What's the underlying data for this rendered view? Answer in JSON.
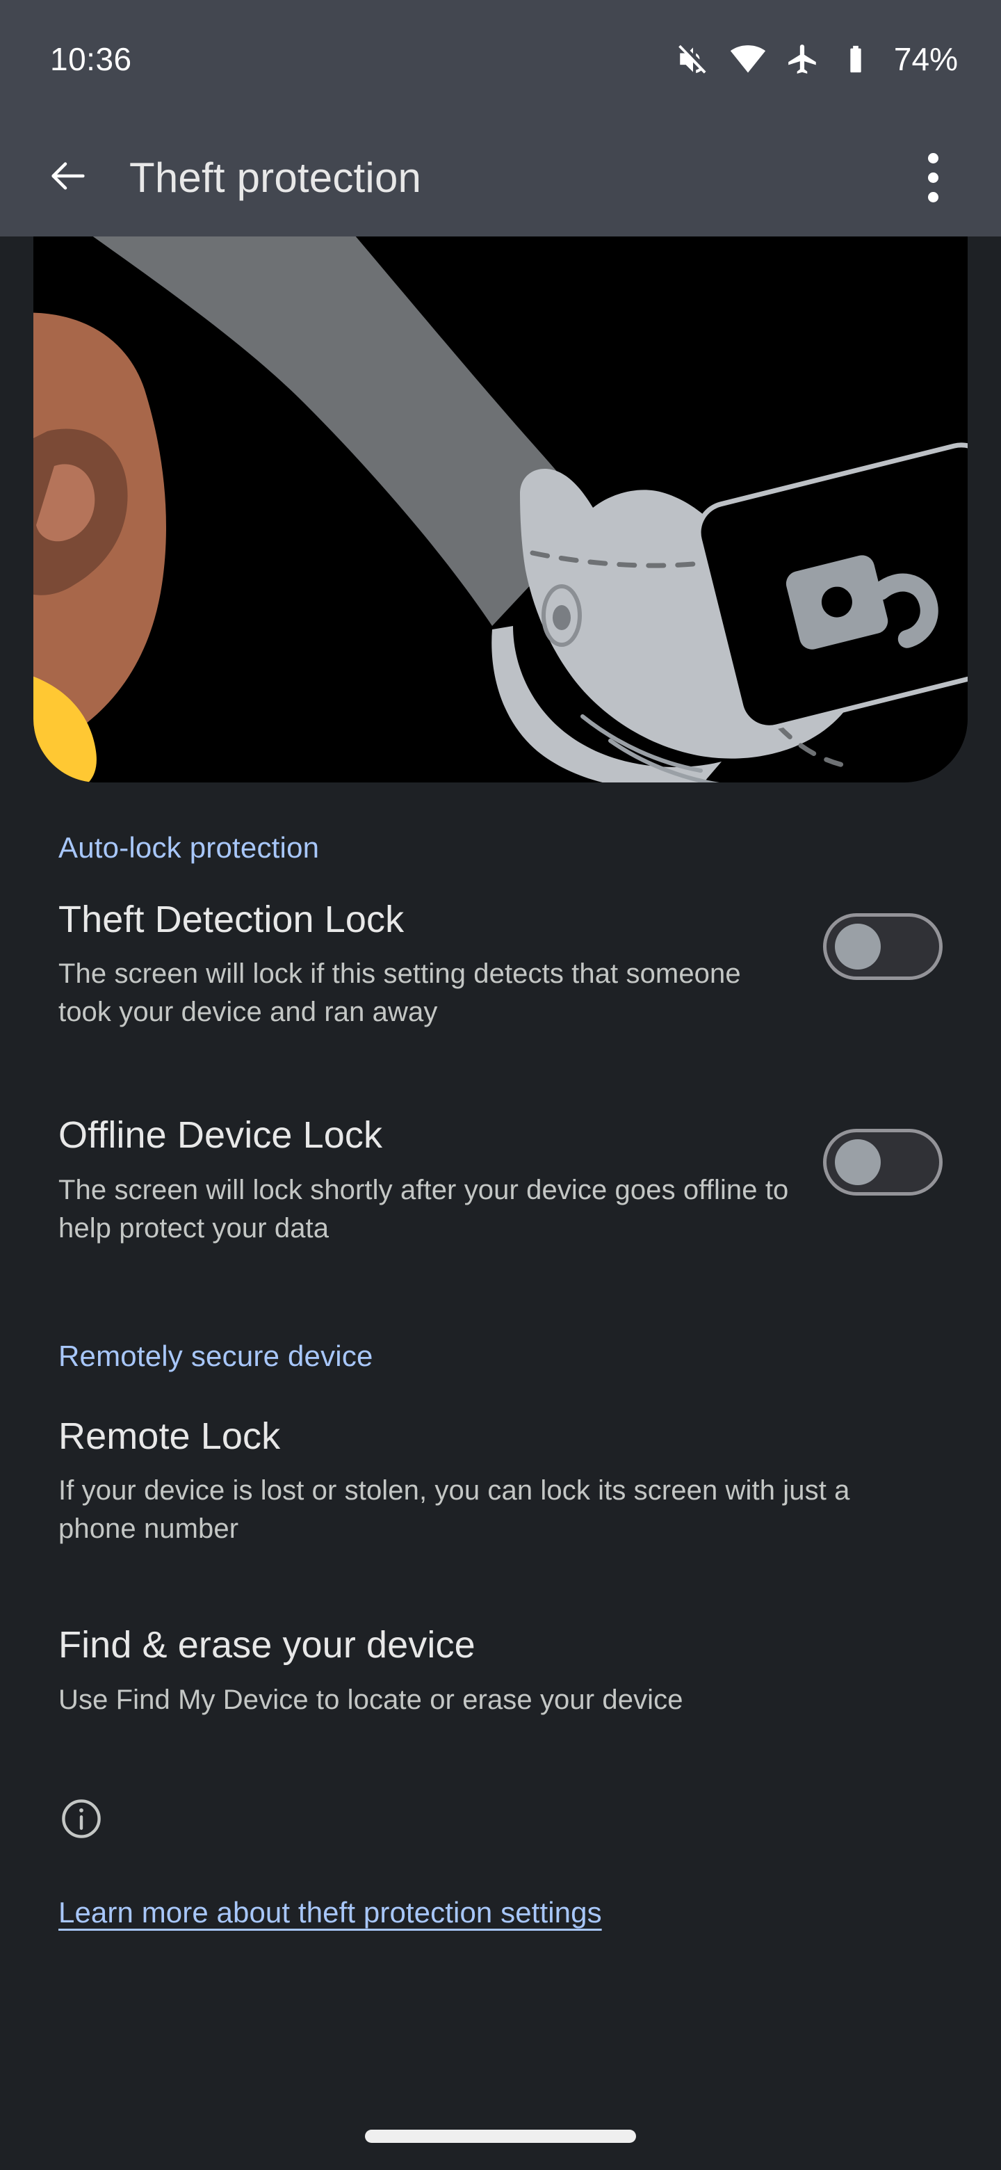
{
  "status_bar": {
    "time": "10:36",
    "battery_percent": "74%",
    "icons": [
      "volume-off-icon",
      "wifi-icon",
      "airplane-mode-icon",
      "battery-icon"
    ]
  },
  "app_bar": {
    "back_icon": "back-arrow-icon",
    "title": "Theft protection",
    "overflow_icon": "more-options-icon"
  },
  "hero": {
    "illustration_name": "theft-snatching-phone-illustration",
    "colors": {
      "background": "#000000",
      "thief_sleeve": "#6E7174",
      "thief_glove": "#BDC1C6",
      "victim_hand": "#A8674A",
      "victim_hand_shadow": "#7B4A36",
      "victim_sleeve": "#FFC833",
      "phone_screen": "#000000",
      "phone_frame": "#BDC1C6",
      "lock_icon": "#9AA0A6"
    }
  },
  "sections": [
    {
      "header": "Auto-lock protection",
      "items": [
        {
          "title": "Theft Detection Lock",
          "summary": "The screen will lock if this setting detects that someone took your device and ran away",
          "has_toggle": true,
          "toggle_state": "off"
        },
        {
          "title": "Offline Device Lock",
          "summary": "The screen will lock shortly after your device goes offline to help protect your data",
          "has_toggle": true,
          "toggle_state": "off"
        }
      ]
    },
    {
      "header": "Remotely secure device",
      "items": [
        {
          "title": "Remote Lock",
          "summary": "If your device is lost or stolen, you can lock its screen with just a phone number",
          "has_toggle": false,
          "toggle_state": ""
        },
        {
          "title": "Find & erase your device",
          "summary": "Use Find My Device to locate or erase your device",
          "has_toggle": false,
          "toggle_state": ""
        }
      ]
    }
  ],
  "footer": {
    "info_icon": "info-icon",
    "link_text": "Learn more about theft protection settings"
  },
  "theme": {
    "page_background": "#1E2125",
    "bar_background": "#434750",
    "accent_blue": "#A8C7FA",
    "primary_text": "#E8E8E8",
    "secondary_text": "#C4C7C5"
  }
}
